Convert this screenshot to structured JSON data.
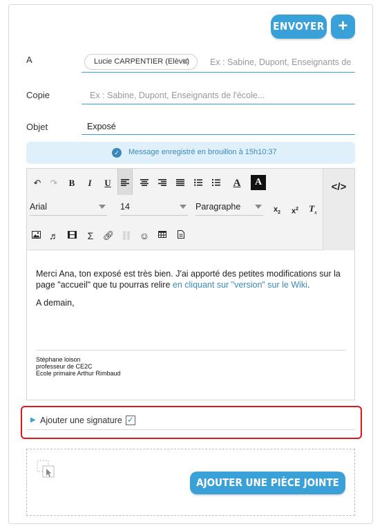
{
  "header": {
    "send_label": "ENVOYER",
    "plus_label": "+"
  },
  "to": {
    "label": "A",
    "chip_name": "Lucie CARPENTIER (Elève)",
    "chip_remove": "✖",
    "placeholder": "Ex : Sabine, Dupont, Enseignants de l'é"
  },
  "cc": {
    "label": "Copie",
    "placeholder": "Ex : Sabine, Dupont, Enseignants de l'école..."
  },
  "subject": {
    "label": "Objet",
    "value": "Exposé"
  },
  "banner": {
    "text": "Message enregistré en brouillon à 15h10:37",
    "icon": "check-icon"
  },
  "toolbar": {
    "font": "Arial",
    "size": "14",
    "format": "Paragraphe",
    "code_label": "</>"
  },
  "message": {
    "line1_a": "Merci Ana, ton exposé est très bien. J'ai apporté des petites modifications sur la page \"accueil\" que tu pourras relire ",
    "line1_link": "en cliquant sur \"version\" sur le Wiki",
    "line1_end": ".",
    "line2": "A demain,"
  },
  "signature": {
    "name": "Stéphane loison",
    "role": "professeur de CE2C",
    "school": "Ecole primaire Arthur Rimbaud"
  },
  "signature_toggle": {
    "label": "Ajouter une signature",
    "checked": true,
    "check": "✓"
  },
  "attachment": {
    "button_label": "AJOUTER UNE PIÈCE JOINTE"
  },
  "colors": {
    "accent": "#3aa0d8",
    "highlight": "#e0161b",
    "banner_bg": "#dff0fa"
  }
}
